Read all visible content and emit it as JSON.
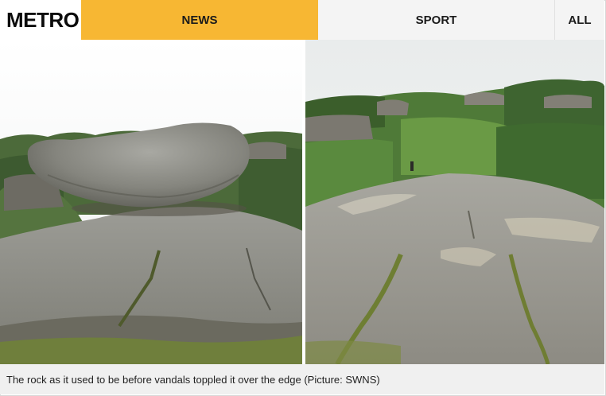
{
  "header": {
    "logo_text": "METRO",
    "tabs": [
      {
        "label": "NEWS",
        "active": true,
        "color": "#f7b733"
      },
      {
        "label": "SPORT",
        "active": false
      },
      {
        "label": "ALL",
        "active": false
      }
    ]
  },
  "gallery": {
    "images": [
      {
        "description_icon": "photo-balanced-rock-before"
      },
      {
        "description_icon": "photo-rock-after-toppled"
      }
    ],
    "caption": "The rock as it used to be before vandals toppled it over the edge (Picture: SWNS)"
  }
}
